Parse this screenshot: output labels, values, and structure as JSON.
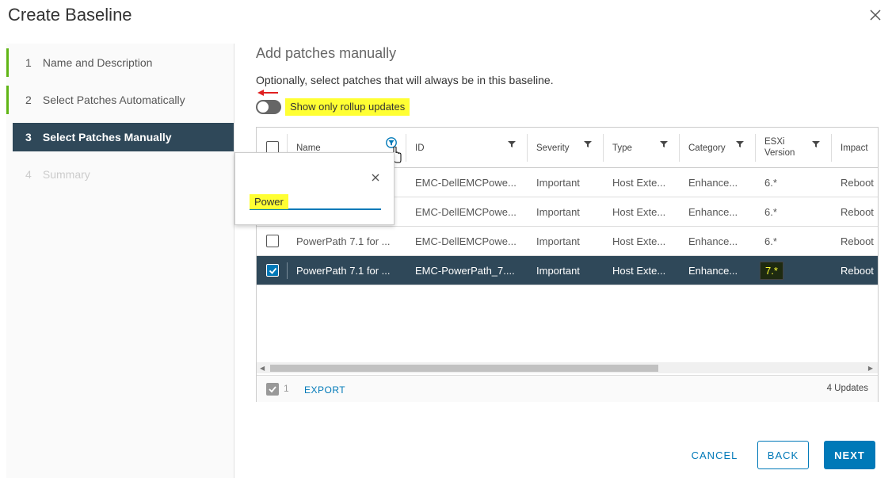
{
  "dialog": {
    "title": "Create Baseline"
  },
  "steps": [
    {
      "num": "1",
      "label": "Name and Description",
      "state": "done"
    },
    {
      "num": "2",
      "label": "Select Patches Automatically",
      "state": "done"
    },
    {
      "num": "3",
      "label": "Select Patches Manually",
      "state": "active"
    },
    {
      "num": "4",
      "label": "Summary",
      "state": "disabled"
    }
  ],
  "main": {
    "heading": "Add patches manually",
    "subtext": "Optionally, select patches that will always be in this baseline.",
    "toggle_label": "Show only rollup updates"
  },
  "grid": {
    "columns": [
      {
        "label": "Name",
        "filter": "active"
      },
      {
        "label": "ID",
        "filter": "default"
      },
      {
        "label": "Severity",
        "filter": "default"
      },
      {
        "label": "Type",
        "filter": "default"
      },
      {
        "label": "Category",
        "filter": "default"
      },
      {
        "label": "ESXi Version",
        "filter": "default"
      },
      {
        "label": "Impact",
        "filter": "none"
      }
    ],
    "rows": [
      {
        "name": "",
        "id": "EMC-DellEMCPowe...",
        "severity": "Important",
        "type": "Host Exte...",
        "category": "Enhance...",
        "esxi": "6.*",
        "impact": "Reboot",
        "checked": false,
        "selected": false
      },
      {
        "name": "",
        "id": "EMC-DellEMCPowe...",
        "severity": "Important",
        "type": "Host Exte...",
        "category": "Enhance...",
        "esxi": "6.*",
        "impact": "Reboot",
        "checked": false,
        "selected": false
      },
      {
        "name": "PowerPath 7.1 for ...",
        "id": "EMC-DellEMCPowe...",
        "severity": "Important",
        "type": "Host Exte...",
        "category": "Enhance...",
        "esxi": "6.*",
        "impact": "Reboot",
        "checked": false,
        "selected": false
      },
      {
        "name": "PowerPath 7.1 for ...",
        "id": "EMC-PowerPath_7....",
        "severity": "Important",
        "type": "Host Exte...",
        "category": "Enhance...",
        "esxi": "7.*",
        "impact": "Reboot",
        "checked": true,
        "selected": true
      }
    ],
    "footer": {
      "selected_count": "1",
      "export_label": "EXPORT",
      "total": "4 Updates"
    }
  },
  "filter_popup": {
    "value": "Power"
  },
  "buttons": {
    "cancel": "CANCEL",
    "back": "BACK",
    "next": "NEXT"
  },
  "colors": {
    "accent": "#0079b8",
    "active_step": "#2f4859",
    "done_step": "#60b515",
    "highlight": "#ffff33"
  }
}
